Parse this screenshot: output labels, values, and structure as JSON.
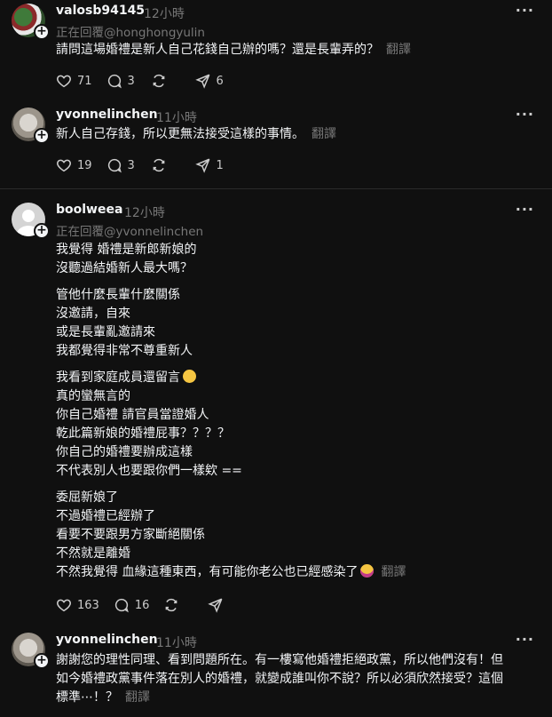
{
  "posts": [
    {
      "username": "valosb94145",
      "time": "12小時",
      "reply_to": "正在回覆@honghongyulin",
      "body": "請問這場婚禮是新人自己花錢自己辦的嗎？還是長輩弄的？",
      "translate": "翻譯",
      "likes": "71",
      "comments": "3",
      "reposts": "",
      "shares": "6"
    },
    {
      "username": "yvonnelinchen",
      "time": "11小時",
      "body": "新人自己存錢，所以更無法接受這樣的事情。",
      "translate": "翻譯",
      "likes": "19",
      "comments": "3",
      "reposts": "",
      "shares": "1"
    },
    {
      "username": "boolweea",
      "time": "12小時",
      "reply_to": "正在回覆@yvonnelinchen",
      "paragraphs": [
        "我覺得 婚禮是新郎新娘的\n沒聽過結婚新人最大嗎？",
        "管他什麼長輩什麼關係\n沒邀請，自來\n或是長輩亂邀請來\n我都覺得非常不尊重新人",
        "我看到家庭成員還留言",
        "真的蠻無言的\n你自己婚禮 請官員當證婚人\n乾此篇新娘的婚禮屁事？？？？\n你自己的婚禮要辦成這樣\n不代表別人也要跟你們一樣欸 ==",
        "委屈新娘了\n不過婚禮已經辦了\n看要不要跟男方家斷絕關係\n不然就是離婚",
        "不然我覺得 血緣這種東西，有可能你老公也已經感染了"
      ],
      "translate": "翻譯",
      "likes": "163",
      "comments": "16",
      "reposts": "",
      "shares": ""
    },
    {
      "username": "yvonnelinchen",
      "time": "11小時",
      "body_lines": [
        "謝謝您的理性同理、看到問題所在。有一樓寫他婚禮拒絕政黨，所以他們沒有！但",
        "如今婚禮政黨事件落在別人的婚禮，就變成誰叫你不說？所以必須欣然接受？這個",
        "標準⋯！？"
      ],
      "translate": "翻譯"
    }
  ],
  "icons": {
    "like": "heart-icon",
    "comment": "comment-icon",
    "repost": "repost-icon",
    "share": "share-icon",
    "more": "more-icon"
  },
  "more_label": "···",
  "plus_label": "+",
  "colors": {
    "background": "#101010",
    "text": "#f3f5f7",
    "muted": "#777777",
    "divider": "#2a2a2a"
  }
}
